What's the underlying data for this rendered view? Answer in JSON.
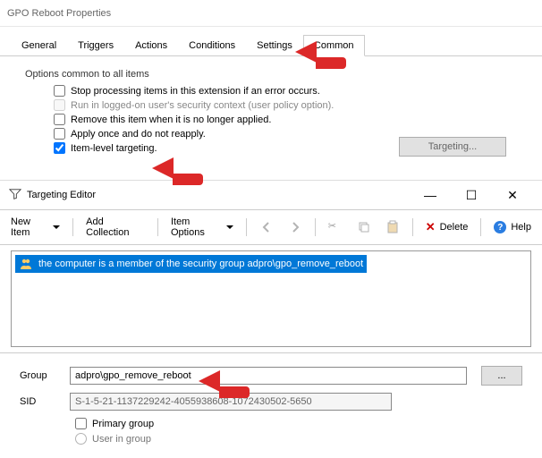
{
  "window": {
    "title": "GPO Reboot Properties"
  },
  "tabs": [
    "General",
    "Triggers",
    "Actions",
    "Conditions",
    "Settings",
    "Common"
  ],
  "activeTab": "Common",
  "common": {
    "heading": "Options common to all items",
    "opt_stop": "Stop processing items in this extension if an error occurs.",
    "opt_run": "Run in logged-on user's security context (user policy option).",
    "opt_remove": "Remove this item when it is no longer applied.",
    "opt_apply": "Apply once and do not reapply.",
    "opt_itemlevel": "Item-level targeting.",
    "targeting_btn": "Targeting..."
  },
  "editor": {
    "title": "Targeting Editor",
    "toolbar": {
      "newitem": "New Item",
      "addcollection": "Add Collection",
      "itemoptions": "Item Options",
      "delete": "Delete",
      "help": "Help"
    },
    "item_text": "the computer is a member of the security group adpro\\gpo_remove_reboot",
    "fields": {
      "group_label": "Group",
      "group_value": "adpro\\gpo_remove_reboot",
      "browse": "...",
      "sid_label": "SID",
      "sid_value": "S-1-5-21-1137229242-4055938608-1072430502-5650",
      "primary": "Primary group",
      "useringroup": "User in group"
    }
  }
}
